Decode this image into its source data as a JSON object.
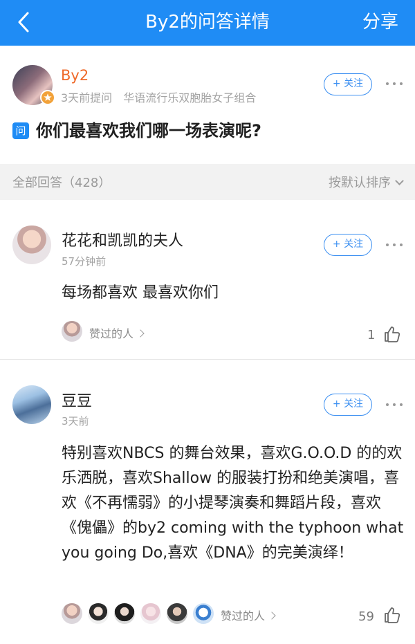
{
  "header": {
    "back_icon": "chevron-left-icon",
    "title": "By2的问答详情",
    "share_label": "分享",
    "bg_color": "#1f8cf5"
  },
  "question": {
    "author_name": "By2",
    "author_name_color": "#ef6a2a",
    "asked_time": "3天前提问",
    "author_desc": "华语流行乐双胞胎女子组合",
    "follow_label": "+ 关注",
    "badge_label": "问",
    "title": "你们最喜欢我们哪一场表演呢?"
  },
  "answers_bar": {
    "count_label": "全部回答（428）",
    "sort_label": "按默认排序"
  },
  "answers": [
    {
      "name": "花花和凯凯的夫人",
      "time": "57分钟前",
      "follow_label": "+ 关注",
      "body": "每场都喜欢 最喜欢你们",
      "liked_label": "赞过的人",
      "like_count": "1"
    },
    {
      "name": "豆豆",
      "time": "3天前",
      "follow_label": "+ 关注",
      "body": "特别喜欢NBCS 的舞台效果，喜欢G.O.O.D 的的欢乐洒脱，喜欢Shallow 的服装打扮和绝美演唱，喜欢《不再懦弱》的小提琴演奏和舞蹈片段，喜欢《傀儡》的by2 coming with the typhoon what you going Do,喜欢《DNA》的完美演绎！",
      "liked_label": "赞过的人",
      "like_count": "59"
    }
  ]
}
